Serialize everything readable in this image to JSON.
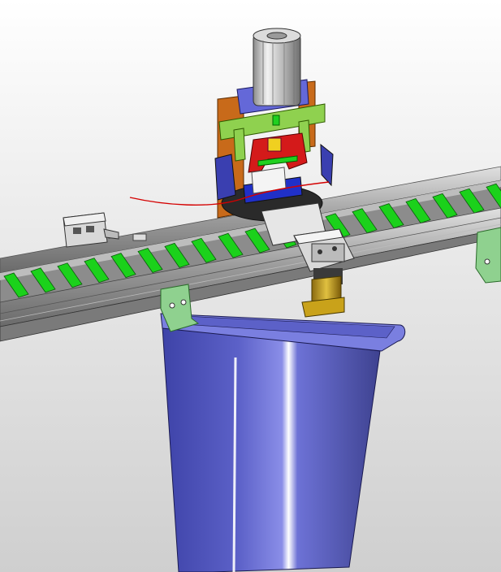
{
  "scene": {
    "colors": {
      "conveyor_flight": "#1bd11b",
      "conveyor_rail": "#9a9a9a",
      "bin_body": "#5a5fbf",
      "bin_rim": "#7a7fe0",
      "cylinder": "#c9c9c9",
      "press_frame": "#c86a1a",
      "press_plate": "#8fd14f",
      "blade_holder": "#d41a1a",
      "wire": "#d40000",
      "gripper_body": "#d8d8d8",
      "gripper_post": "#c9a21a",
      "bracket": "#8fd18f"
    }
  }
}
